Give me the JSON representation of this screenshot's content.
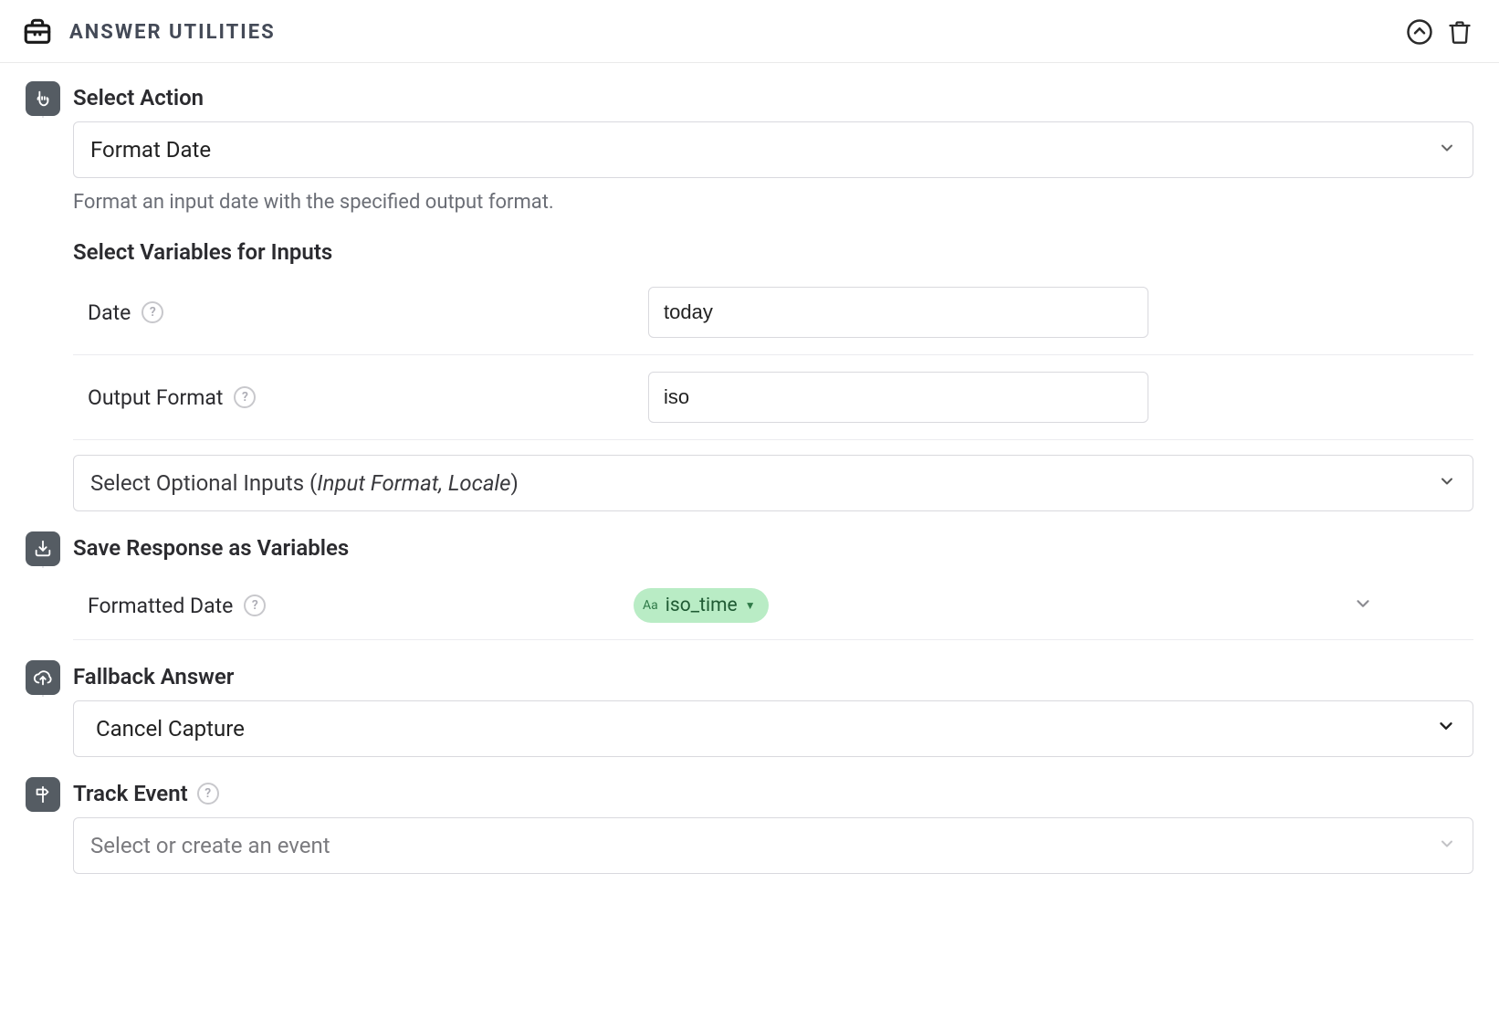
{
  "header": {
    "title": "ANSWER UTILITIES"
  },
  "action": {
    "label": "Select Action",
    "selected": "Format Date",
    "description": "Format an input date with the specified output format."
  },
  "inputs": {
    "heading": "Select Variables for Inputs",
    "rows": [
      {
        "label": "Date",
        "value": "today"
      },
      {
        "label": "Output Format",
        "value": "iso"
      }
    ],
    "optional_placeholder_prefix": "Select Optional Inputs (",
    "optional_placeholder_italic": "Input Format, Locale",
    "optional_placeholder_suffix": ")"
  },
  "save": {
    "label": "Save Response as Variables",
    "row_label": "Formatted Date",
    "chip_prefix": "Aa",
    "chip_value": "iso_time"
  },
  "fallback": {
    "label": "Fallback Answer",
    "selected": "Cancel Capture"
  },
  "track": {
    "label": "Track Event",
    "placeholder": "Select or create an event"
  }
}
